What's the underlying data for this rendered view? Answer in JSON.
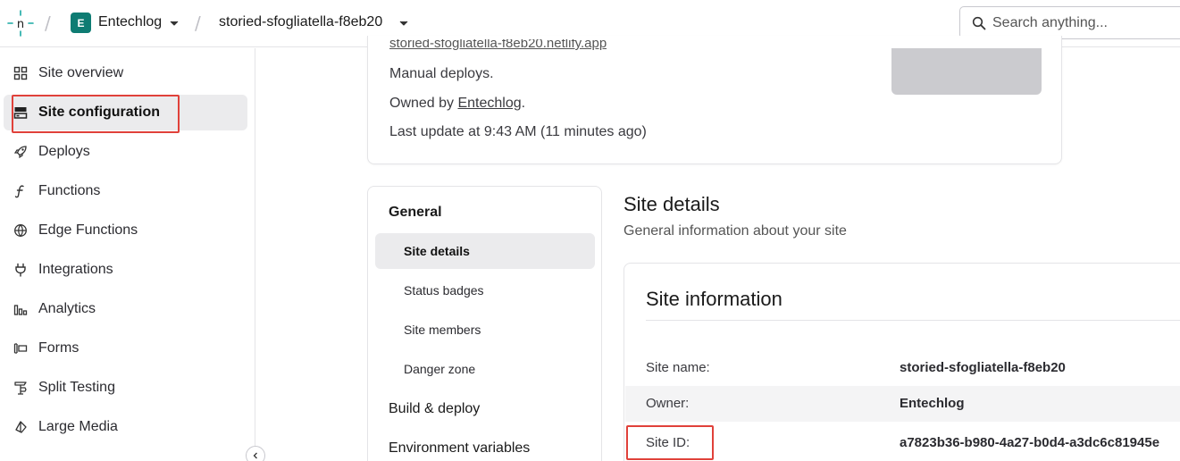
{
  "header": {
    "team_initial": "E",
    "team_name": "Entechlog",
    "site_name": "storied-sfogliatella-f8eb20",
    "search_placeholder": "Search anything..."
  },
  "sidebar": {
    "items": [
      {
        "label": "Site overview",
        "icon": "grid-icon"
      },
      {
        "label": "Site configuration",
        "icon": "server-icon",
        "active": true
      },
      {
        "label": "Deploys",
        "icon": "rocket-icon"
      },
      {
        "label": "Functions",
        "icon": "function-icon"
      },
      {
        "label": "Edge Functions",
        "icon": "globe-icon"
      },
      {
        "label": "Integrations",
        "icon": "plug-icon"
      },
      {
        "label": "Analytics",
        "icon": "bar-chart-icon"
      },
      {
        "label": "Forms",
        "icon": "form-icon"
      },
      {
        "label": "Split Testing",
        "icon": "split-icon"
      },
      {
        "label": "Large Media",
        "icon": "image-icon"
      }
    ]
  },
  "overview_card": {
    "site_url": "storied-sfogliatella-f8eb20.netlify.app",
    "deploy_mode": "Manual deploys.",
    "owned_prefix": "Owned by ",
    "owner_link": "Entechlog",
    "owned_suffix": ".",
    "last_update": "Last update at 9:43 AM (11 minutes ago)"
  },
  "subnav": {
    "general_heading": "General",
    "items": [
      "Site details",
      "Status badges",
      "Site members",
      "Danger zone"
    ],
    "build_deploy": "Build & deploy",
    "env_vars": "Environment variables"
  },
  "main": {
    "title": "Site details",
    "subtitle": "General information about your site",
    "card_title": "Site information",
    "rows": [
      {
        "key": "Site name:",
        "value": "storied-sfogliatella-f8eb20"
      },
      {
        "key": "Owner:",
        "value": "Entechlog"
      },
      {
        "key": "Site ID:",
        "value": "a7823b36-b980-4a27-b0d4-a3dc6c81945e"
      }
    ]
  },
  "colors": {
    "accent_teal": "#0e7c73",
    "highlight_red": "#e0413a",
    "active_bg": "#ebebed"
  }
}
